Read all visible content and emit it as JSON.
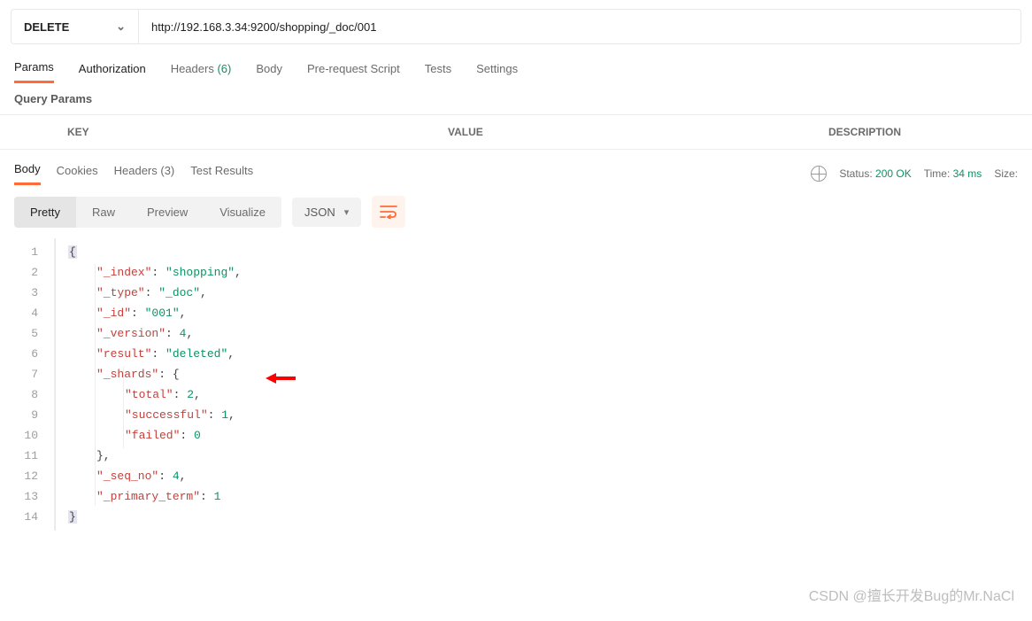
{
  "request": {
    "method": "DELETE",
    "url": "http://192.168.3.34:9200/shopping/_doc/001"
  },
  "tabs": {
    "params": "Params",
    "auth": "Authorization",
    "headers": "Headers",
    "headers_count": "(6)",
    "body": "Body",
    "prereq": "Pre-request Script",
    "tests": "Tests",
    "settings": "Settings"
  },
  "sub_label": "Query Params",
  "table": {
    "key": "KEY",
    "value": "VALUE",
    "desc": "DESCRIPTION"
  },
  "resp_tabs": {
    "body": "Body",
    "cookies": "Cookies",
    "headers": "Headers",
    "headers_count": "(3)",
    "tests": "Test Results"
  },
  "status": {
    "label": "Status:",
    "code": "200 OK",
    "time_label": "Time:",
    "time": "34 ms",
    "size_label": "Size:"
  },
  "view": {
    "pretty": "Pretty",
    "raw": "Raw",
    "preview": "Preview",
    "visualize": "Visualize",
    "lang": "JSON"
  },
  "json_body": {
    "_index": "shopping",
    "_type": "_doc",
    "_id": "001",
    "_version": 4,
    "result": "deleted",
    "_shards": {
      "total": 2,
      "successful": 1,
      "failed": 0
    },
    "_seq_no": 4,
    "_primary_term": 1
  },
  "code_lines": [
    "{",
    "    \"_index\": \"shopping\",",
    "    \"_type\": \"_doc\",",
    "    \"_id\": \"001\",",
    "    \"_version\": 4,",
    "    \"result\": \"deleted\",",
    "    \"_shards\": {",
    "        \"total\": 2,",
    "        \"successful\": 1,",
    "        \"failed\": 0",
    "    },",
    "    \"_seq_no\": 4,",
    "    \"_primary_term\": 1",
    "}"
  ],
  "watermark": "CSDN @擅长开发Bug的Mr.NaCl"
}
